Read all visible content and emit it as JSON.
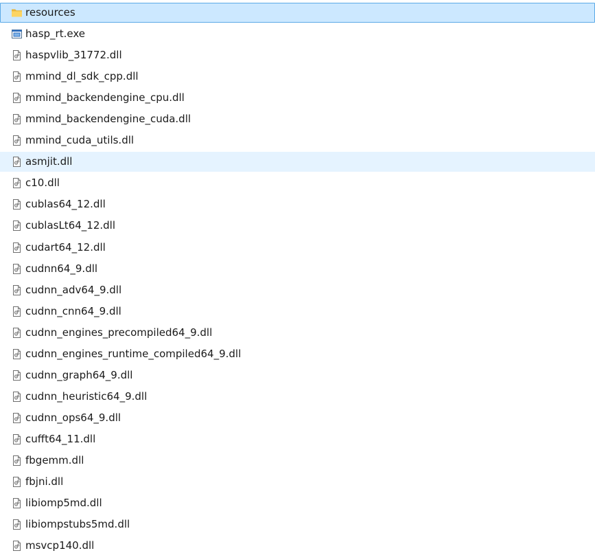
{
  "files": [
    {
      "name": "resources",
      "icon": "folder-icon",
      "state": "selected"
    },
    {
      "name": "hasp_rt.exe",
      "icon": "exe-icon",
      "state": ""
    },
    {
      "name": "haspvlib_31772.dll",
      "icon": "dll-file-icon",
      "state": ""
    },
    {
      "name": "mmind_dl_sdk_cpp.dll",
      "icon": "dll-file-icon",
      "state": ""
    },
    {
      "name": "mmind_backendengine_cpu.dll",
      "icon": "dll-file-icon",
      "state": ""
    },
    {
      "name": "mmind_backendengine_cuda.dll",
      "icon": "dll-file-icon",
      "state": ""
    },
    {
      "name": "mmind_cuda_utils.dll",
      "icon": "dll-file-icon",
      "state": ""
    },
    {
      "name": "asmjit.dll",
      "icon": "dll-file-icon",
      "state": "hover"
    },
    {
      "name": "c10.dll",
      "icon": "dll-file-icon",
      "state": ""
    },
    {
      "name": "cublas64_12.dll",
      "icon": "dll-file-icon",
      "state": ""
    },
    {
      "name": "cublasLt64_12.dll",
      "icon": "dll-file-icon",
      "state": ""
    },
    {
      "name": "cudart64_12.dll",
      "icon": "dll-file-icon",
      "state": ""
    },
    {
      "name": "cudnn64_9.dll",
      "icon": "dll-file-icon",
      "state": ""
    },
    {
      "name": "cudnn_adv64_9.dll",
      "icon": "dll-file-icon",
      "state": ""
    },
    {
      "name": "cudnn_cnn64_9.dll",
      "icon": "dll-file-icon",
      "state": ""
    },
    {
      "name": "cudnn_engines_precompiled64_9.dll",
      "icon": "dll-file-icon",
      "state": ""
    },
    {
      "name": "cudnn_engines_runtime_compiled64_9.dll",
      "icon": "dll-file-icon",
      "state": ""
    },
    {
      "name": "cudnn_graph64_9.dll",
      "icon": "dll-file-icon",
      "state": ""
    },
    {
      "name": "cudnn_heuristic64_9.dll",
      "icon": "dll-file-icon",
      "state": ""
    },
    {
      "name": "cudnn_ops64_9.dll",
      "icon": "dll-file-icon",
      "state": ""
    },
    {
      "name": "cufft64_11.dll",
      "icon": "dll-file-icon",
      "state": ""
    },
    {
      "name": "fbgemm.dll",
      "icon": "dll-file-icon",
      "state": ""
    },
    {
      "name": "fbjni.dll",
      "icon": "dll-file-icon",
      "state": ""
    },
    {
      "name": "libiomp5md.dll",
      "icon": "dll-file-icon",
      "state": ""
    },
    {
      "name": "libiompstubs5md.dll",
      "icon": "dll-file-icon",
      "state": ""
    },
    {
      "name": "msvcp140.dll",
      "icon": "dll-file-icon",
      "state": ""
    }
  ]
}
